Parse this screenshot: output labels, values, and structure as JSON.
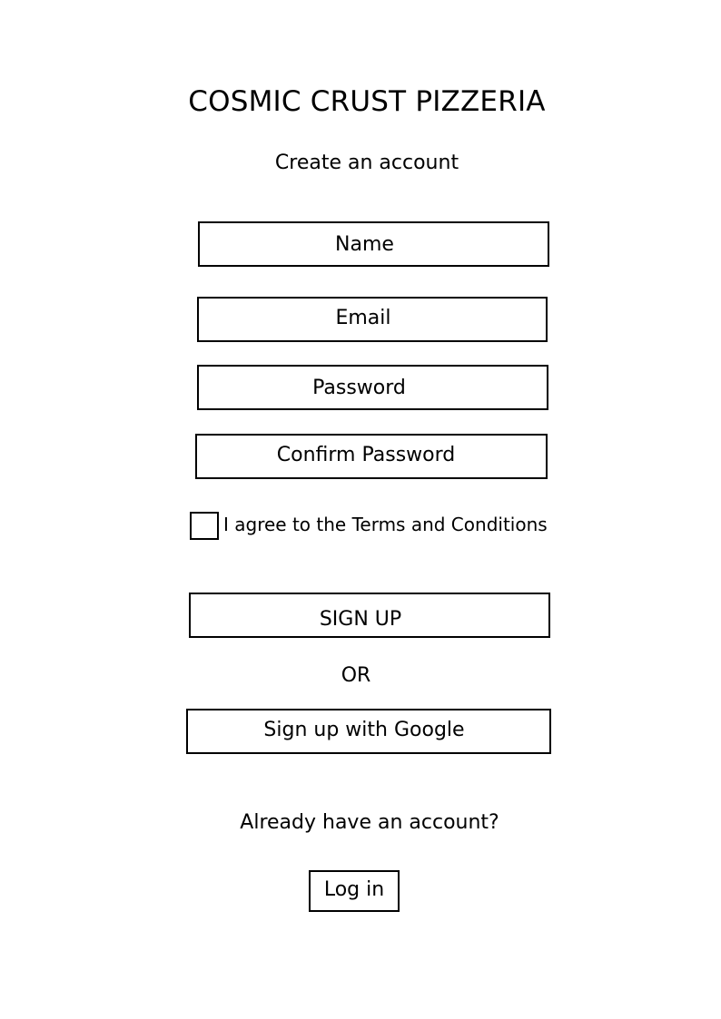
{
  "header": {
    "brand": "COSMIC CRUST PIZZERIA",
    "subtitle": "Create an account"
  },
  "form": {
    "name_placeholder": "Name",
    "email_placeholder": "Email",
    "password_placeholder": "Password",
    "confirm_password_placeholder": "Confirm Password",
    "terms_label": "I agree to the Terms and Conditions",
    "terms_checked": false,
    "signup_label": "SIGN UP",
    "or_label": "OR",
    "google_signup_label": "Sign up with Google"
  },
  "footer": {
    "already_text": "Already have an account?",
    "login_label": "Log in"
  }
}
